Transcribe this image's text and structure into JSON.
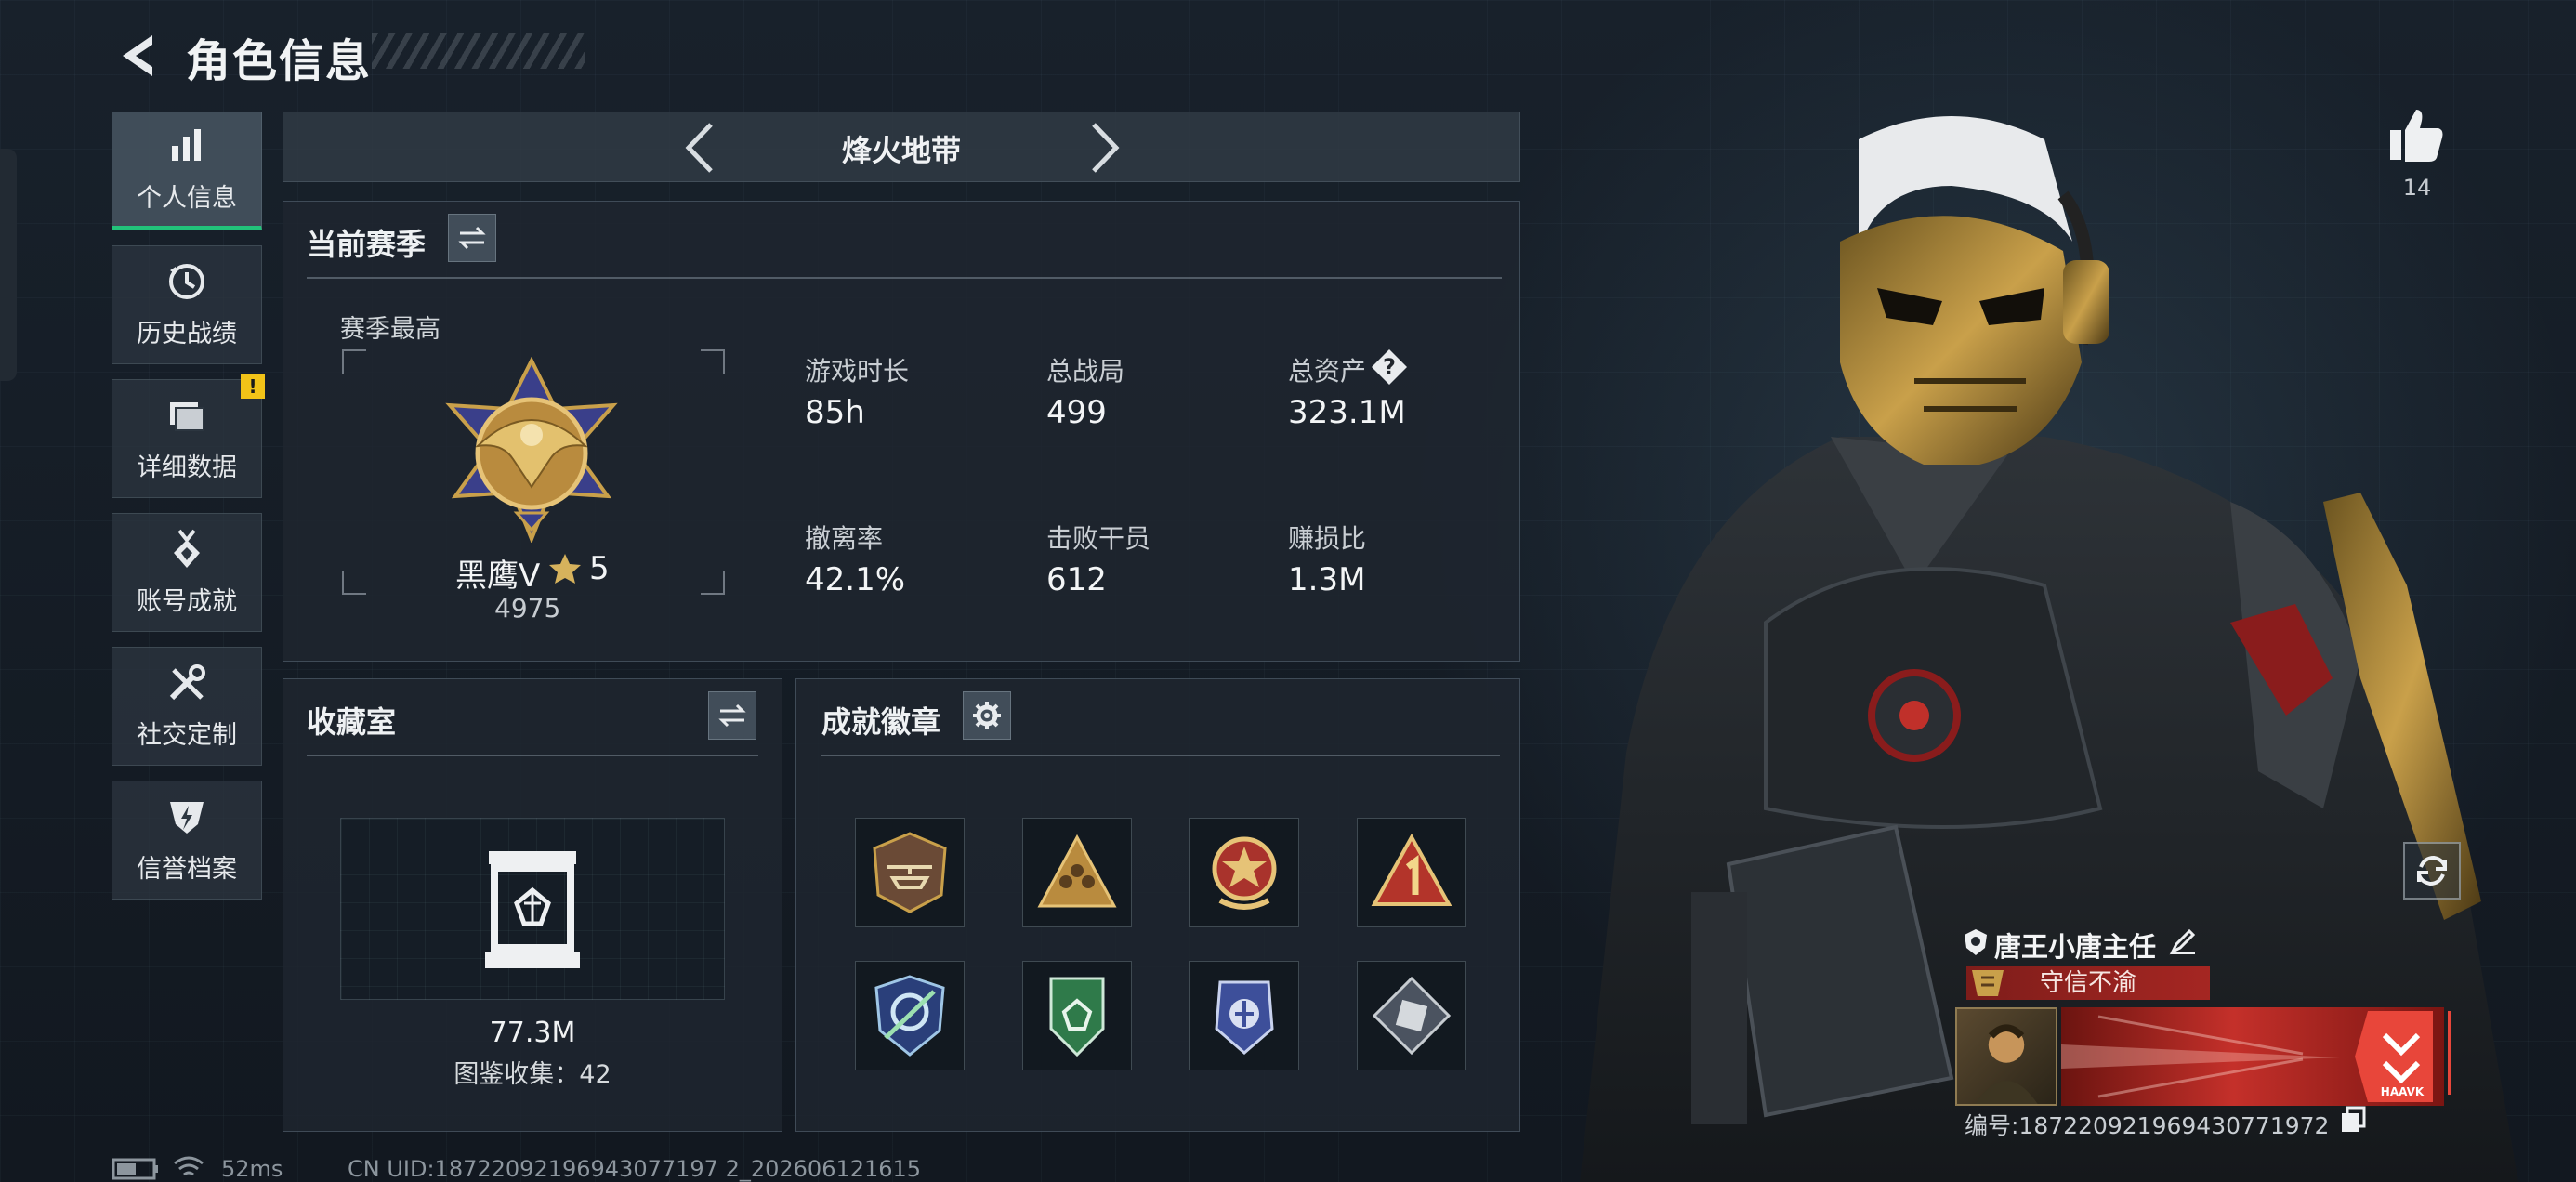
{
  "header": {
    "title": "角色信息"
  },
  "nav": {
    "items": [
      {
        "label": "个人信息",
        "active": true,
        "icon": "bar-chart-icon"
      },
      {
        "label": "历史战绩",
        "icon": "history-clock-icon"
      },
      {
        "label": "详细数据",
        "icon": "folder-icon",
        "badge": "!"
      },
      {
        "label": "账号成就",
        "icon": "achievement-medal-icon"
      },
      {
        "label": "社交定制",
        "icon": "tools-icon"
      },
      {
        "label": "信誉档案",
        "icon": "credit-shield-icon"
      }
    ]
  },
  "mode_selector": {
    "title": "烽火地带"
  },
  "season": {
    "title": "当前赛季",
    "best_label": "赛季最高",
    "rank_name": "黑鹰Ⅴ",
    "rank_stars": "5",
    "rank_points": "4975",
    "stats": [
      {
        "label": "游戏时长",
        "value": "85h"
      },
      {
        "label": "总战局",
        "value": "499"
      },
      {
        "label": "总资产",
        "value": "323.1M"
      },
      {
        "label": "撤离率",
        "value": "42.1%"
      },
      {
        "label": "击败干员",
        "value": "612"
      },
      {
        "label": "赚损比",
        "value": "1.3M"
      }
    ],
    "help_symbol": "?"
  },
  "collection": {
    "title": "收藏室",
    "value": "77.3M",
    "catalog": "图鉴收集：42"
  },
  "achievements": {
    "title": "成就徽章",
    "badges": [
      "helicopter-badge-icon",
      "triangle-squad-badge-icon",
      "star-wreath-badge-icon",
      "number-one-badge-icon",
      "arrows-shield-badge-icon",
      "green-shield-badge-icon",
      "blue-crest-badge-icon",
      "diamond-gear-badge-icon"
    ]
  },
  "footer": {
    "ping": "52ms",
    "uid": "CN UID:18722092196943077197 2_202606121615"
  },
  "character": {
    "likes": "14",
    "name": "唐王小唐主任",
    "title": "守信不渝",
    "card_text": "HAAVK",
    "id_label": "编号:187220921969430771972"
  },
  "colors": {
    "accent_green": "#22c37a",
    "badge_yellow": "#f2c318",
    "title_red": "#a52622",
    "gold": "#c9a04a"
  }
}
